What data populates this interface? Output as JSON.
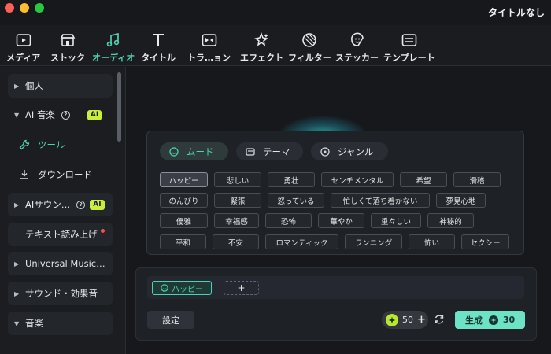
{
  "window": {
    "title": "タイトルなし"
  },
  "toolbar": {
    "items": [
      {
        "label": "メディア",
        "icon": "media-icon"
      },
      {
        "label": "ストック",
        "icon": "stock-icon"
      },
      {
        "label": "オーディオ",
        "icon": "audio-icon",
        "active": true
      },
      {
        "label": "タイトル",
        "icon": "title-icon"
      },
      {
        "label": "トラ…ョン",
        "icon": "transition-icon"
      },
      {
        "label": "エフェクト",
        "icon": "effect-icon"
      },
      {
        "label": "フィルター",
        "icon": "filter-icon"
      },
      {
        "label": "ステッカー",
        "icon": "sticker-icon"
      },
      {
        "label": "テンプレート",
        "icon": "template-icon"
      }
    ]
  },
  "sidebar": {
    "personal": "個人",
    "ai_music": "AI 音楽",
    "ai_badge": "AI",
    "tool": "ツール",
    "download": "ダウンロード",
    "ai_sound": "AIサウン…",
    "tts": "テキスト読み上げ",
    "universal": "Universal Music…",
    "sound_effects": "サウンド・効果音",
    "music": "音楽"
  },
  "popup": {
    "tabs": [
      {
        "label": "ムード",
        "active": true
      },
      {
        "label": "テーマ"
      },
      {
        "label": "ジャンル"
      }
    ],
    "chips": [
      [
        "ハッピー",
        "悲しい",
        "勇壮",
        "センチメンタル",
        "希望",
        "滑稽"
      ],
      [
        "のんびり",
        "緊張",
        "怒っている",
        "忙しくて落ち着かない",
        "夢見心地"
      ],
      [
        "優雅",
        "幸福感",
        "恐怖",
        "華やか",
        "重々しい",
        "神秘的"
      ],
      [
        "平和",
        "不安",
        "ロマンティック",
        "ランニング",
        "怖い",
        "セクシー"
      ]
    ]
  },
  "prompt": {
    "selected_tag": "ハッピー",
    "add_label": "+",
    "settings_label": "設定",
    "credits": "50",
    "generate_label": "生成",
    "generate_cost": "30"
  },
  "colors": {
    "accent": "#4fd2b0",
    "ai_badge": "#c9ef3e",
    "generate": "#6ee2c4"
  }
}
